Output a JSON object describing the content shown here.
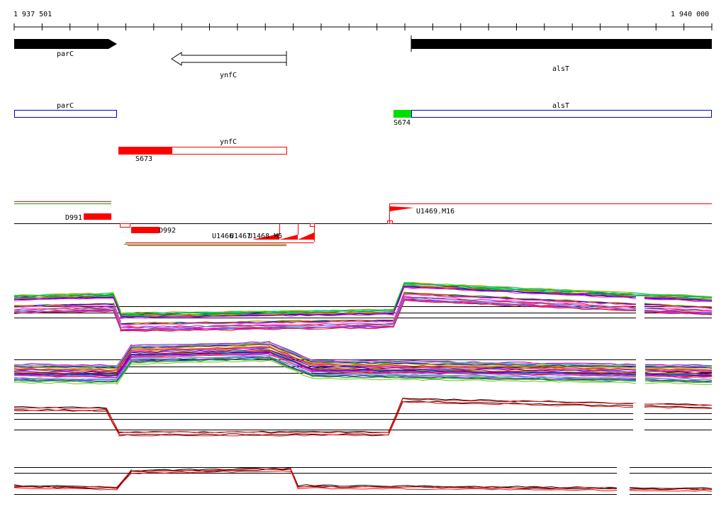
{
  "ruler": {
    "start_label": "1 937 501",
    "end_label": "1 940 000"
  },
  "annotated_genes": [
    {
      "name": "parC",
      "strand": "+"
    },
    {
      "name": "ynfC",
      "strand": "-"
    },
    {
      "name": "alsT",
      "strand": "+"
    }
  ],
  "transcription_units": [
    {
      "label": "parC",
      "color": "#0000cc"
    },
    {
      "label": "alsT",
      "color": "#0000cc"
    },
    {
      "label": "ynfC",
      "color": "#ff0000"
    }
  ],
  "segments": [
    {
      "label": "S674",
      "color": "#00dd00"
    },
    {
      "label": "S673",
      "color": "#ff0000"
    }
  ],
  "features": {
    "downshifts": [
      "D991",
      "D992"
    ],
    "upshifts": [
      "U1469.M16",
      "U1466",
      "U1467",
      "U1468.M5"
    ]
  },
  "colors": {
    "accent_red": "#ff0000",
    "accent_green": "#00dd00",
    "gene_outline": "#0000cc",
    "gene_fill": "#000000"
  }
}
